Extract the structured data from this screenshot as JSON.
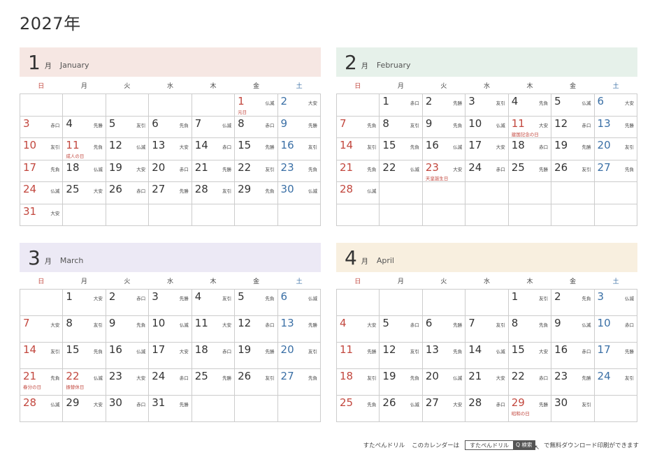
{
  "page_title": "2027年",
  "weekdays": [
    "日",
    "月",
    "火",
    "水",
    "木",
    "金",
    "土"
  ],
  "footer": {
    "brand": "すたぺんドリル",
    "lead": "このカレンダーは",
    "box_name": "すたぺんドリル",
    "search_button": "Q 検索",
    "tail": "で無料ダウンロード印刷ができます"
  },
  "colors": {
    "sunday": "#c2473e",
    "saturday": "#3a6fa5",
    "jan_header": "#f6e7e3",
    "feb_header": "#e6f1ea",
    "mar_header": "#ece9f5",
    "apr_header": "#f8efdf"
  },
  "months": [
    {
      "num": "1",
      "kanji": "月",
      "en": "January",
      "weeks": [
        [
          null,
          null,
          null,
          null,
          null,
          {
            "d": "1",
            "r": "仏滅",
            "h": "元日"
          },
          {
            "d": "2",
            "r": "大安"
          }
        ],
        [
          {
            "d": "3",
            "r": "赤口"
          },
          {
            "d": "4",
            "r": "先勝"
          },
          {
            "d": "5",
            "r": "友引"
          },
          {
            "d": "6",
            "r": "先負"
          },
          {
            "d": "7",
            "r": "仏滅"
          },
          {
            "d": "8",
            "r": "赤口"
          },
          {
            "d": "9",
            "r": "先勝"
          }
        ],
        [
          {
            "d": "10",
            "r": "友引"
          },
          {
            "d": "11",
            "r": "先負",
            "h": "成人の日"
          },
          {
            "d": "12",
            "r": "仏滅"
          },
          {
            "d": "13",
            "r": "大安"
          },
          {
            "d": "14",
            "r": "赤口"
          },
          {
            "d": "15",
            "r": "先勝"
          },
          {
            "d": "16",
            "r": "友引"
          }
        ],
        [
          {
            "d": "17",
            "r": "先負"
          },
          {
            "d": "18",
            "r": "仏滅"
          },
          {
            "d": "19",
            "r": "大安"
          },
          {
            "d": "20",
            "r": "赤口"
          },
          {
            "d": "21",
            "r": "先勝"
          },
          {
            "d": "22",
            "r": "友引"
          },
          {
            "d": "23",
            "r": "先負"
          }
        ],
        [
          {
            "d": "24",
            "r": "仏滅"
          },
          {
            "d": "25",
            "r": "大安"
          },
          {
            "d": "26",
            "r": "赤口"
          },
          {
            "d": "27",
            "r": "先勝"
          },
          {
            "d": "28",
            "r": "友引"
          },
          {
            "d": "29",
            "r": "先負"
          },
          {
            "d": "30",
            "r": "仏滅"
          }
        ],
        [
          {
            "d": "31",
            "r": "大安"
          },
          null,
          null,
          null,
          null,
          null,
          null
        ]
      ]
    },
    {
      "num": "2",
      "kanji": "月",
      "en": "February",
      "weeks": [
        [
          null,
          {
            "d": "1",
            "r": "赤口"
          },
          {
            "d": "2",
            "r": "先勝"
          },
          {
            "d": "3",
            "r": "友引"
          },
          {
            "d": "4",
            "r": "先負"
          },
          {
            "d": "5",
            "r": "仏滅"
          },
          {
            "d": "6",
            "r": "大安"
          }
        ],
        [
          {
            "d": "7",
            "r": "先負"
          },
          {
            "d": "8",
            "r": "友引"
          },
          {
            "d": "9",
            "r": "先負"
          },
          {
            "d": "10",
            "r": "仏滅"
          },
          {
            "d": "11",
            "r": "大安",
            "h": "建国記念の日"
          },
          {
            "d": "12",
            "r": "赤口"
          },
          {
            "d": "13",
            "r": "先勝"
          }
        ],
        [
          {
            "d": "14",
            "r": "友引"
          },
          {
            "d": "15",
            "r": "先負"
          },
          {
            "d": "16",
            "r": "仏滅"
          },
          {
            "d": "17",
            "r": "大安"
          },
          {
            "d": "18",
            "r": "赤口"
          },
          {
            "d": "19",
            "r": "先勝"
          },
          {
            "d": "20",
            "r": "友引"
          }
        ],
        [
          {
            "d": "21",
            "r": "先負"
          },
          {
            "d": "22",
            "r": "仏滅"
          },
          {
            "d": "23",
            "r": "大安",
            "h": "天皇誕生日"
          },
          {
            "d": "24",
            "r": "赤口"
          },
          {
            "d": "25",
            "r": "先勝"
          },
          {
            "d": "26",
            "r": "友引"
          },
          {
            "d": "27",
            "r": "先負"
          }
        ],
        [
          {
            "d": "28",
            "r": "仏滅"
          },
          null,
          null,
          null,
          null,
          null,
          null
        ],
        [
          null,
          null,
          null,
          null,
          null,
          null,
          null
        ]
      ]
    },
    {
      "num": "3",
      "kanji": "月",
      "en": "March",
      "weeks": [
        [
          null,
          {
            "d": "1",
            "r": "大安"
          },
          {
            "d": "2",
            "r": "赤口"
          },
          {
            "d": "3",
            "r": "先勝"
          },
          {
            "d": "4",
            "r": "友引"
          },
          {
            "d": "5",
            "r": "先負"
          },
          {
            "d": "6",
            "r": "仏滅"
          }
        ],
        [
          {
            "d": "7",
            "r": "大安"
          },
          {
            "d": "8",
            "r": "友引"
          },
          {
            "d": "9",
            "r": "先負"
          },
          {
            "d": "10",
            "r": "仏滅"
          },
          {
            "d": "11",
            "r": "大安"
          },
          {
            "d": "12",
            "r": "赤口"
          },
          {
            "d": "13",
            "r": "先勝"
          }
        ],
        [
          {
            "d": "14",
            "r": "友引"
          },
          {
            "d": "15",
            "r": "先負"
          },
          {
            "d": "16",
            "r": "仏滅"
          },
          {
            "d": "17",
            "r": "大安"
          },
          {
            "d": "18",
            "r": "赤口"
          },
          {
            "d": "19",
            "r": "先勝"
          },
          {
            "d": "20",
            "r": "友引"
          }
        ],
        [
          {
            "d": "21",
            "r": "先負",
            "h": "春分の日"
          },
          {
            "d": "22",
            "r": "仏滅",
            "h": "振替休日"
          },
          {
            "d": "23",
            "r": "大安"
          },
          {
            "d": "24",
            "r": "赤口"
          },
          {
            "d": "25",
            "r": "先勝"
          },
          {
            "d": "26",
            "r": "友引"
          },
          {
            "d": "27",
            "r": "先負"
          }
        ],
        [
          {
            "d": "28",
            "r": "仏滅"
          },
          {
            "d": "29",
            "r": "大安"
          },
          {
            "d": "30",
            "r": "赤口"
          },
          {
            "d": "31",
            "r": "先勝"
          },
          null,
          null,
          null
        ]
      ]
    },
    {
      "num": "4",
      "kanji": "月",
      "en": "April",
      "weeks": [
        [
          null,
          null,
          null,
          null,
          {
            "d": "1",
            "r": "友引"
          },
          {
            "d": "2",
            "r": "先負"
          },
          {
            "d": "3",
            "r": "仏滅"
          }
        ],
        [
          {
            "d": "4",
            "r": "大安"
          },
          {
            "d": "5",
            "r": "赤口"
          },
          {
            "d": "6",
            "r": "先勝"
          },
          {
            "d": "7",
            "r": "友引"
          },
          {
            "d": "8",
            "r": "先負"
          },
          {
            "d": "9",
            "r": "仏滅"
          },
          {
            "d": "10",
            "r": "赤口"
          }
        ],
        [
          {
            "d": "11",
            "r": "先勝"
          },
          {
            "d": "12",
            "r": "友引"
          },
          {
            "d": "13",
            "r": "先負"
          },
          {
            "d": "14",
            "r": "仏滅"
          },
          {
            "d": "15",
            "r": "大安"
          },
          {
            "d": "16",
            "r": "赤口"
          },
          {
            "d": "17",
            "r": "先勝"
          }
        ],
        [
          {
            "d": "18",
            "r": "友引"
          },
          {
            "d": "19",
            "r": "先負"
          },
          {
            "d": "20",
            "r": "仏滅"
          },
          {
            "d": "21",
            "r": "大安"
          },
          {
            "d": "22",
            "r": "赤口"
          },
          {
            "d": "23",
            "r": "先勝"
          },
          {
            "d": "24",
            "r": "友引"
          }
        ],
        [
          {
            "d": "25",
            "r": "先負"
          },
          {
            "d": "26",
            "r": "仏滅"
          },
          {
            "d": "27",
            "r": "大安"
          },
          {
            "d": "28",
            "r": "赤口"
          },
          {
            "d": "29",
            "r": "先勝",
            "h": "昭和の日"
          },
          {
            "d": "30",
            "r": "友引"
          },
          null
        ]
      ]
    }
  ]
}
